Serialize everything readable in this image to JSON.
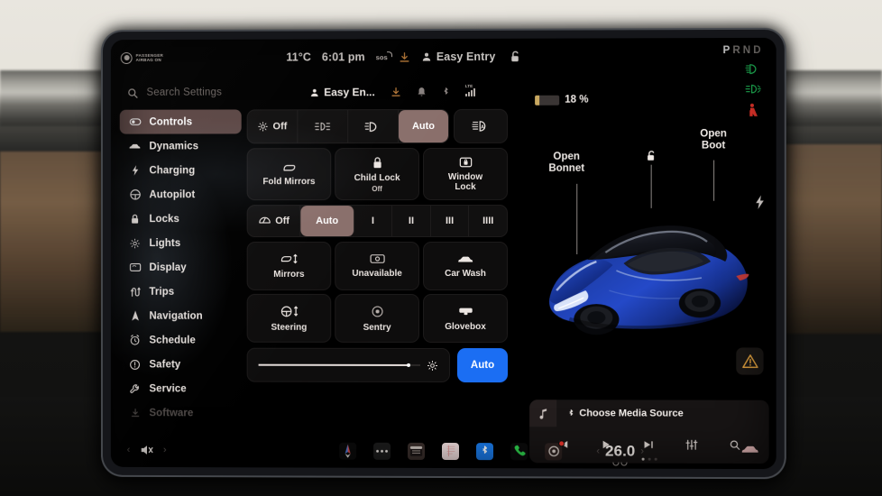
{
  "status_bar": {
    "airbag_line1": "PASSENGER",
    "airbag_line2": "AIRBAG ON",
    "temperature": "11°C",
    "time": "6:01 pm",
    "sos_label": "sos",
    "profile_name": "Easy Entry",
    "download_icon": "download-icon",
    "person_icon": "person-icon",
    "lock_icon": "unlock-icon"
  },
  "search": {
    "placeholder": "Search Settings",
    "icon": "search-icon",
    "profile_name": "Easy En...",
    "icons": [
      "download-icon",
      "bell-icon",
      "bluetooth-icon",
      "lte-signal-icon"
    ],
    "lte_label": "LTE"
  },
  "sidebar": {
    "items": [
      {
        "label": "Controls",
        "icon": "toggle-icon",
        "selected": true,
        "faded": false
      },
      {
        "label": "Dynamics",
        "icon": "car-icon",
        "selected": false,
        "faded": false
      },
      {
        "label": "Charging",
        "icon": "bolt-icon",
        "selected": false,
        "faded": false
      },
      {
        "label": "Autopilot",
        "icon": "steering-icon",
        "selected": false,
        "faded": false
      },
      {
        "label": "Locks",
        "icon": "lock-icon",
        "selected": false,
        "faded": false
      },
      {
        "label": "Lights",
        "icon": "sun-icon",
        "selected": false,
        "faded": false
      },
      {
        "label": "Display",
        "icon": "display-icon",
        "selected": false,
        "faded": false
      },
      {
        "label": "Trips",
        "icon": "route-icon",
        "selected": false,
        "faded": false
      },
      {
        "label": "Navigation",
        "icon": "navigation-icon",
        "selected": false,
        "faded": false
      },
      {
        "label": "Schedule",
        "icon": "alarm-icon",
        "selected": false,
        "faded": false
      },
      {
        "label": "Safety",
        "icon": "warning-circle-icon",
        "selected": false,
        "faded": false
      },
      {
        "label": "Service",
        "icon": "wrench-icon",
        "selected": false,
        "faded": false
      },
      {
        "label": "Software",
        "icon": "download-icon",
        "selected": false,
        "faded": true
      }
    ]
  },
  "headlights": {
    "options": [
      {
        "label": "Off",
        "icon": "headlight-off-icon",
        "selected": false
      },
      {
        "label": "",
        "icon": "parking-light-icon",
        "selected": false
      },
      {
        "label": "",
        "icon": "low-beam-icon",
        "selected": false
      },
      {
        "label": "Auto",
        "icon": "",
        "selected": true
      }
    ],
    "auto_high_beam_icon": "auto-high-beam-icon"
  },
  "tiles_row": [
    {
      "label": "Fold Mirrors",
      "sub": "",
      "icon": "mirror-icon"
    },
    {
      "label": "Child Lock",
      "sub": "Off",
      "icon": "child-lock-icon"
    },
    {
      "label": "Window\nLock",
      "sub": "",
      "icon": "window-lock-icon"
    }
  ],
  "wipers": {
    "options": [
      {
        "label": "Off",
        "icon": "wiper-icon",
        "selected": false
      },
      {
        "label": "Auto",
        "icon": "",
        "selected": true
      },
      {
        "label": "I",
        "icon": "",
        "selected": false
      },
      {
        "label": "II",
        "icon": "",
        "selected": false
      },
      {
        "label": "III",
        "icon": "",
        "selected": false
      },
      {
        "label": "IIII",
        "icon": "",
        "selected": false
      }
    ]
  },
  "grid_tiles": [
    {
      "label": "Mirrors",
      "icon": "mirror-adjust-icon"
    },
    {
      "label": "Unavailable",
      "icon": "camera-icon"
    },
    {
      "label": "Car Wash",
      "icon": "car-wash-icon"
    },
    {
      "label": "Steering",
      "icon": "steering-adjust-icon"
    },
    {
      "label": "Sentry",
      "icon": "sentry-icon"
    },
    {
      "label": "Glovebox",
      "icon": "glovebox-icon"
    }
  ],
  "brightness": {
    "value_pct": 93,
    "icon": "brightness-icon",
    "auto_label": "Auto",
    "auto_color": "#1b6ef3"
  },
  "vehicle": {
    "battery_pct": "18 %",
    "battery_level": 18,
    "battery_color": "#c9a961",
    "gear_letters": "PRND",
    "gear_selected": "P",
    "telltales": [
      {
        "icon": "low-beam-telltale-icon",
        "color": "#22c55e"
      },
      {
        "icon": "front-fog-telltale-icon",
        "color": "#22c55e"
      },
      {
        "icon": "seatbelt-telltale-icon",
        "color": "#e5342b"
      }
    ],
    "open_bonnet_label": "Open\nBonnet",
    "open_boot_label": "Open\nBoot",
    "roof_icon": "unlock-icon",
    "charge_port_icon": "bolt-icon",
    "warning_icon": "warning-triangle-icon",
    "car_color": "#1e3fae"
  },
  "media": {
    "title": "Choose Media Source",
    "title_prefix_icon": "bluetooth-icon",
    "album_icon": "music-note-icon",
    "controls": [
      "previous-icon",
      "play-icon",
      "next-icon",
      "equalizer-icon",
      "search-icon"
    ],
    "page_dots": 3,
    "active_dot": 0
  },
  "bottom_bar": {
    "volume_icon": "volume-mute-icon",
    "prev_arrow": "‹",
    "next_arrow": "›",
    "apps": [
      {
        "name": "navigation-app-icon",
        "bg": "#0b0b0b",
        "badge": false
      },
      {
        "name": "more-apps-icon",
        "bg": "#1c1c1c",
        "badge": false
      },
      {
        "name": "calendar-app-icon",
        "bg": "#3a2f2c",
        "badge": false
      },
      {
        "name": "notes-app-icon",
        "bg": "#f0dede",
        "badge": false
      },
      {
        "name": "bluetooth-app-icon",
        "bg": "#1a7ae8",
        "badge": false
      },
      {
        "name": "phone-app-icon",
        "bg": "#0b0b0b",
        "badge": false
      },
      {
        "name": "dashcam-app-icon",
        "bg": "#2d2220",
        "badge": true
      }
    ],
    "temperature": "26.0",
    "temp_prev": "‹",
    "temp_next": "›",
    "hvac_car_icon": "hvac-car-icon"
  }
}
